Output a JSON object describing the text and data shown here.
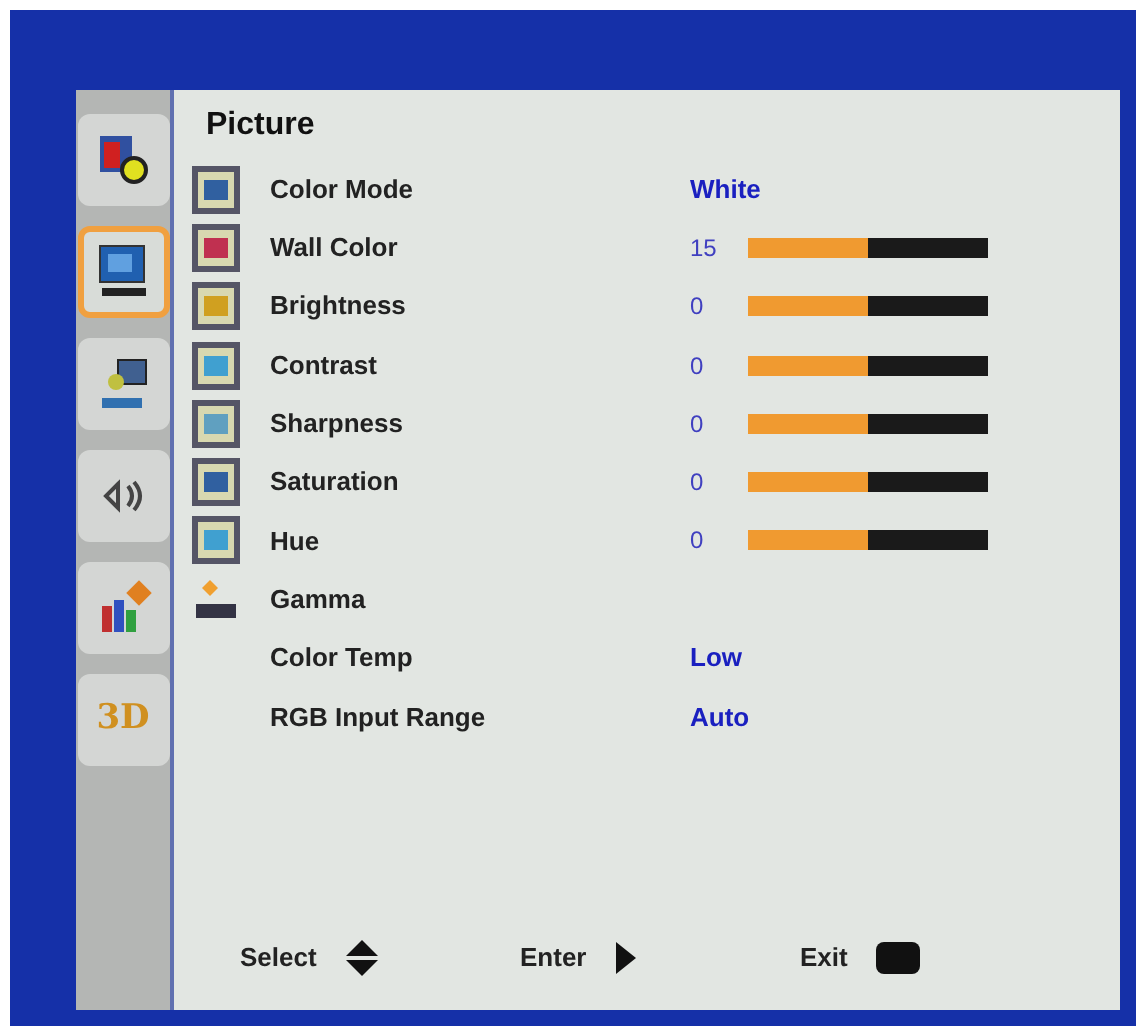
{
  "sidebar": {
    "items": [
      {
        "kind": "icon",
        "selected": false
      },
      {
        "kind": "icon",
        "selected": true
      },
      {
        "kind": "icon",
        "selected": false
      },
      {
        "kind": "icon",
        "selected": false
      },
      {
        "kind": "icon",
        "selected": false
      },
      {
        "kind": "text",
        "label": "3D",
        "selected": false
      }
    ]
  },
  "panel": {
    "title": "Picture",
    "items": [
      {
        "kind": "value",
        "label": "Color Mode",
        "value": "White"
      },
      {
        "kind": "slider",
        "label": "Wall Color",
        "reading": "15",
        "level": 0.5
      },
      {
        "kind": "slider",
        "label": "Brightness",
        "reading": "0",
        "level": 0.5
      },
      {
        "kind": "slider",
        "label": "Contrast",
        "reading": "0",
        "level": 0.5
      },
      {
        "kind": "slider",
        "label": "Sharpness",
        "reading": "0",
        "level": 0.5
      },
      {
        "kind": "slider",
        "label": "Saturation",
        "reading": "0",
        "level": 0.5
      },
      {
        "kind": "slider",
        "label": "Hue",
        "reading": "0",
        "level": 0.5
      },
      {
        "kind": "plain",
        "label": "Gamma"
      },
      {
        "kind": "value",
        "label": "Color Temp",
        "value": "Low"
      },
      {
        "kind": "value",
        "label": "RGB Input Range",
        "value": "Auto"
      }
    ]
  },
  "footer": {
    "hints": [
      {
        "label": "Select"
      },
      {
        "label": "Enter"
      },
      {
        "label": "Exit"
      }
    ]
  }
}
